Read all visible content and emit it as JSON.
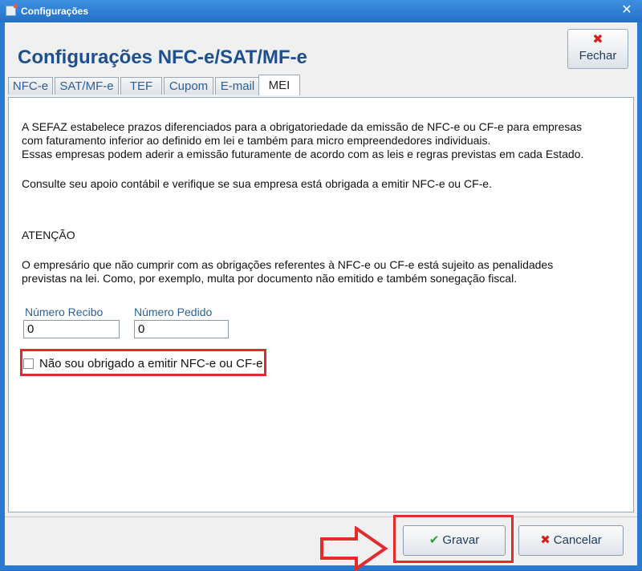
{
  "window": {
    "title": "Configurações"
  },
  "header": {
    "title": "Configurações NFC-e/SAT/MF-e",
    "close_label": "Fechar"
  },
  "tabs": [
    {
      "label": "NFC-e"
    },
    {
      "label": "SAT/MF-e"
    },
    {
      "label": "TEF"
    },
    {
      "label": "Cupom"
    },
    {
      "label": "E-mail"
    },
    {
      "label": "MEI",
      "active": true
    }
  ],
  "mei": {
    "p1_line1": "A SEFAZ estabelece prazos diferenciados para a obrigatoriedade da emissão de NFC-e ou CF-e para empresas",
    "p1_line2": "com faturamento inferior ao definido em lei e também para micro empreendedores individuais.",
    "p1_line3": "Essas empresas podem aderir a emissão futuramente de acordo com as leis e regras previstas em cada Estado.",
    "p2": "Consulte seu apoio contábil e verifique se sua empresa está obrigada a emitir NFC-e ou CF-e.",
    "attention": "ATENÇÃO",
    "p3_line1": "O empresário que não cumprir com as obrigações referentes à NFC-e ou CF-e está sujeito as penalidades",
    "p3_line2": "previstas na lei. Como, por exemplo, multa por documento não emitido e também sonegação fiscal.",
    "numero_recibo_label": "Número Recibo",
    "numero_recibo_value": "0",
    "numero_pedido_label": "Número Pedido",
    "numero_pedido_value": "0",
    "checkbox_label": "Não sou obrigado a emitir NFC-e ou CF-e",
    "checkbox_checked": false
  },
  "footer": {
    "save_label": "Gravar",
    "cancel_label": "Cancelar"
  },
  "colors": {
    "accent": "#1e4f8f",
    "highlight": "#e32b2b",
    "titlebar": "#2a7ad0"
  }
}
